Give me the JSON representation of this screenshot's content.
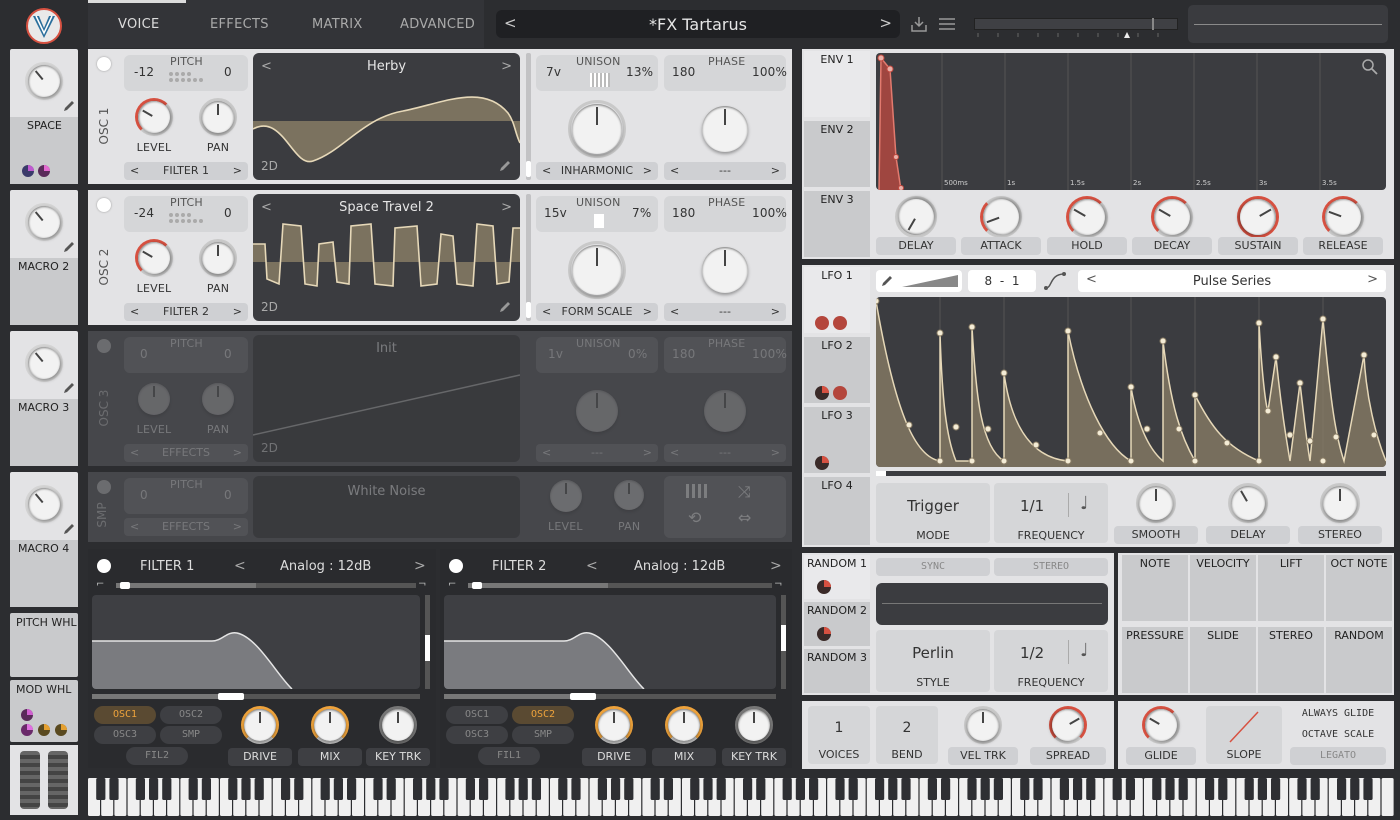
{
  "header": {
    "tabs": [
      "VOICE",
      "EFFECTS",
      "MATRIX",
      "ADVANCED"
    ],
    "active_tab": "VOICE",
    "preset": "*FX Tartarus",
    "prev": "<",
    "next": ">"
  },
  "macros": [
    {
      "label": "SPACE"
    },
    {
      "label": "MACRO 2"
    },
    {
      "label": "MACRO 3"
    },
    {
      "label": "MACRO 4"
    }
  ],
  "wheels": {
    "pitch": "PITCH WHL",
    "mod": "MOD WHL"
  },
  "osc": [
    {
      "name": "OSC 1",
      "pitch_lo": "-12",
      "pitch_label": "PITCH",
      "pitch_hi": "0",
      "level": "LEVEL",
      "pan": "PAN",
      "dest": "FILTER 1",
      "wave": "Herby",
      "dim": "2D",
      "unison_voices": "7v",
      "unison_label": "UNISON",
      "unison_detune": "13%",
      "phase_val": "180",
      "phase_label": "PHASE",
      "phase_rand": "100%",
      "spectral": "INHARMONIC",
      "phase_mode": "---"
    },
    {
      "name": "OSC 2",
      "pitch_lo": "-24",
      "pitch_label": "PITCH",
      "pitch_hi": "0",
      "level": "LEVEL",
      "pan": "PAN",
      "dest": "FILTER 2",
      "wave": "Space Travel 2",
      "dim": "2D",
      "unison_voices": "15v",
      "unison_label": "UNISON",
      "unison_detune": "7%",
      "phase_val": "180",
      "phase_label": "PHASE",
      "phase_rand": "100%",
      "spectral": "FORM SCALE",
      "phase_mode": "---"
    },
    {
      "name": "OSC 3",
      "pitch_lo": "0",
      "pitch_label": "PITCH",
      "pitch_hi": "0",
      "level": "LEVEL",
      "pan": "PAN",
      "dest": "EFFECTS",
      "wave": "Init",
      "dim": "2D",
      "unison_voices": "1v",
      "unison_label": "UNISON",
      "unison_detune": "0%",
      "phase_val": "180",
      "phase_label": "PHASE",
      "phase_rand": "100%",
      "spectral": "---",
      "phase_mode": "---"
    }
  ],
  "smp": {
    "name": "SMP",
    "pitch_lo": "0",
    "pitch_label": "PITCH",
    "pitch_hi": "0",
    "dest": "EFFECTS",
    "sample": "White Noise",
    "level": "LEVEL",
    "pan": "PAN"
  },
  "filters": [
    {
      "name": "FILTER 1",
      "model": "Analog",
      "sep": ":",
      "slope": "12dB",
      "routes": [
        "OSC1",
        "OSC2",
        "OSC3",
        "SMP",
        "FIL2"
      ],
      "drive": "DRIVE",
      "mix": "MIX",
      "keytrk": "KEY TRK"
    },
    {
      "name": "FILTER 2",
      "model": "Analog",
      "sep": ":",
      "slope": "12dB",
      "routes": [
        "OSC1",
        "OSC2",
        "OSC3",
        "SMP",
        "FIL1"
      ],
      "drive": "DRIVE",
      "mix": "MIX",
      "keytrk": "KEY TRK"
    }
  ],
  "env": {
    "tabs": [
      "ENV 1",
      "ENV 2",
      "ENV 3"
    ],
    "times": [
      "500ms",
      "1s",
      "1.5s",
      "2s",
      "2.5s",
      "3s",
      "3.5s"
    ],
    "knobs": [
      "DELAY",
      "ATTACK",
      "HOLD",
      "DECAY",
      "SUSTAIN",
      "RELEASE"
    ]
  },
  "lfo": {
    "tabs": [
      "LFO 1",
      "LFO 2",
      "LFO 3",
      "LFO 4"
    ],
    "grid": "8",
    "dash": "-",
    "grid2": "1",
    "preset": "Pulse Series",
    "mode_val": "Trigger",
    "mode": "MODE",
    "freq_val": "1/1",
    "freq": "FREQUENCY",
    "knobs": [
      "SMOOTH",
      "DELAY",
      "STEREO"
    ]
  },
  "random": {
    "tabs": [
      "RANDOM 1",
      "RANDOM 2",
      "RANDOM 3"
    ],
    "sync": "SYNC",
    "stereo": "STEREO",
    "style_val": "Perlin",
    "style": "STYLE",
    "freq_val": "1/2",
    "freq": "FREQUENCY"
  },
  "mods": [
    "NOTE",
    "VELOCITY",
    "LIFT",
    "OCT NOTE",
    "PRESSURE",
    "SLIDE",
    "STEREO",
    "RANDOM"
  ],
  "voice": {
    "voices_val": "1",
    "voices": "VOICES",
    "bend_val": "2",
    "bend": "BEND",
    "veltrk": "VEL TRK",
    "spread": "SPREAD"
  },
  "glide": {
    "glide": "GLIDE",
    "slope": "SLOPE",
    "always": "ALWAYS GLIDE",
    "octave": "OCTAVE SCALE",
    "legato": "LEGATO"
  },
  "colors": {
    "accent_red": "#d75141",
    "accent_orange": "#eea33c",
    "wave_fill": "#8c7f67",
    "wave_line": "#e6d8b8"
  }
}
